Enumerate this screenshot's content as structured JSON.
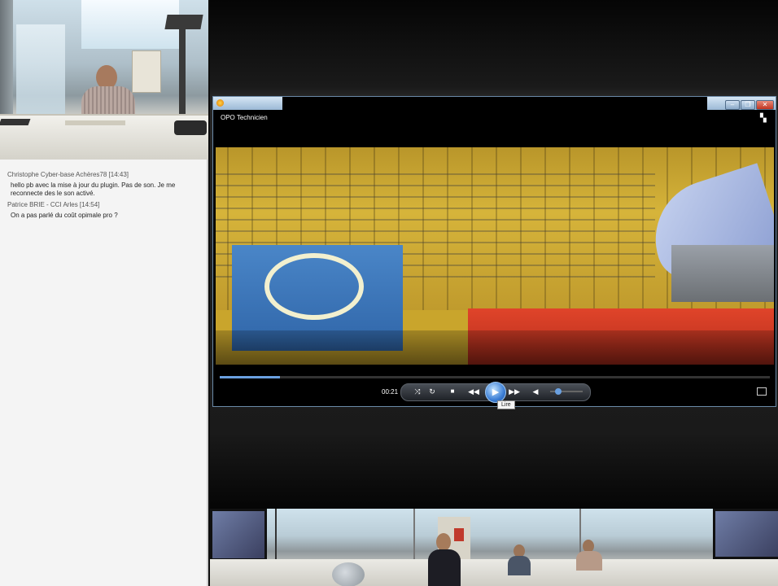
{
  "chat": {
    "messages": [
      {
        "author": "Christophe Cyber-base Achères78",
        "time": "[14:43]",
        "text": "hello pb avec la mise à jour du plugin. Pas de son. Je me reconnecte des le son activé."
      },
      {
        "author": "Patrice BRIE - CCI Arles",
        "time": "[14:54]",
        "text": "On a pas parlé du coût opimale pro ?"
      }
    ]
  },
  "player": {
    "title": "OPO Technicien",
    "time": "00:21",
    "tooltip": "Lire",
    "progress": 0.11,
    "volume": 0.25,
    "icons": {
      "shuffle": "shuffle-icon",
      "repeat": "repeat-icon",
      "stop": "stop-icon",
      "previous": "previous-icon",
      "play": "play-icon",
      "next": "next-icon",
      "volume": "volume-icon",
      "switch_library": "switch-library-icon",
      "fullscreen": "fullscreen-icon"
    },
    "accent": "#3d7fd6"
  }
}
